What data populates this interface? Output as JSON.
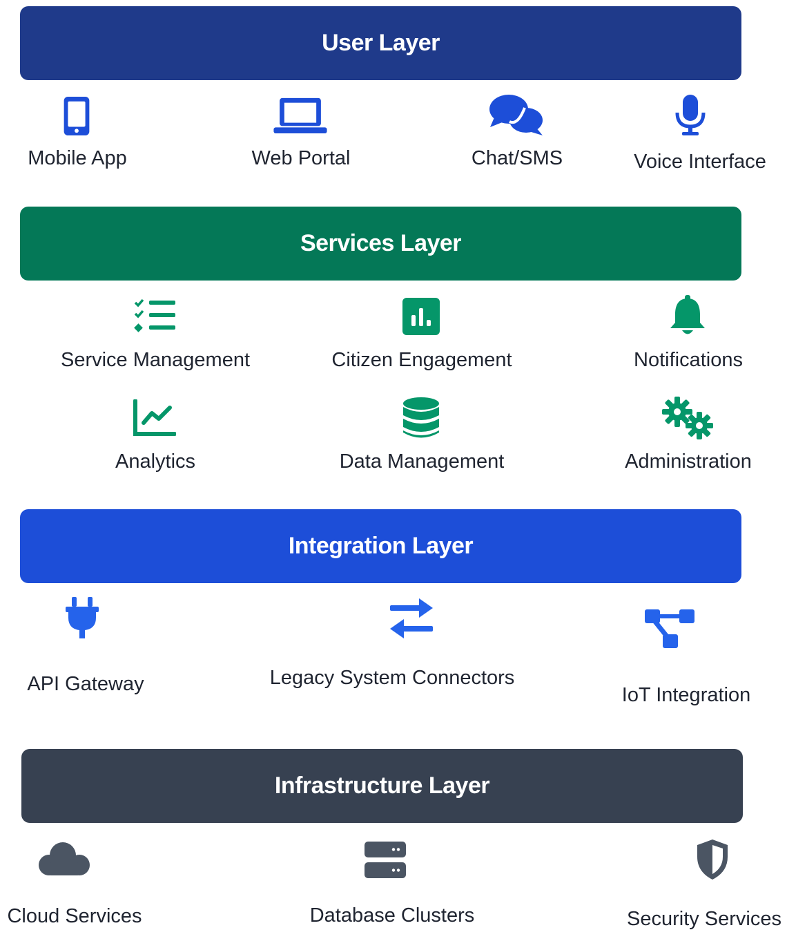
{
  "colors": {
    "user": "#1f3a8a",
    "services": "#047857",
    "integration": "#1d4ed8",
    "infrastructure": "#374151",
    "user_icon": "#1d4ed8",
    "services_icon": "#059669",
    "integration_icon": "#2563eb",
    "infrastructure_icon": "#4b5563"
  },
  "user_layer": {
    "title": "User Layer",
    "items": [
      {
        "label": "Mobile App",
        "icon": "mobile-icon"
      },
      {
        "label": "Web Portal",
        "icon": "laptop-icon"
      },
      {
        "label": "Chat/SMS",
        "icon": "chat-icon"
      },
      {
        "label": "Voice Interface",
        "icon": "microphone-icon"
      }
    ]
  },
  "services_layer": {
    "title": "Services Layer",
    "items": [
      {
        "label": "Service Management",
        "icon": "task-list-icon"
      },
      {
        "label": "Citizen Engagement",
        "icon": "bar-chart-icon"
      },
      {
        "label": "Notifications",
        "icon": "bell-icon"
      },
      {
        "label": "Analytics",
        "icon": "line-chart-icon"
      },
      {
        "label": "Data Management",
        "icon": "database-icon"
      },
      {
        "label": "Administration",
        "icon": "gears-icon"
      }
    ]
  },
  "integration_layer": {
    "title": "Integration Layer",
    "items": [
      {
        "label": "API Gateway",
        "icon": "plug-icon"
      },
      {
        "label": "Legacy System Connectors",
        "icon": "exchange-icon"
      },
      {
        "label": "IoT Integration",
        "icon": "network-icon"
      }
    ]
  },
  "infrastructure_layer": {
    "title": "Infrastructure Layer",
    "items": [
      {
        "label": "Cloud Services",
        "icon": "cloud-icon"
      },
      {
        "label": "Database Clusters",
        "icon": "server-icon"
      },
      {
        "label": "Security Services",
        "icon": "shield-icon"
      }
    ]
  }
}
